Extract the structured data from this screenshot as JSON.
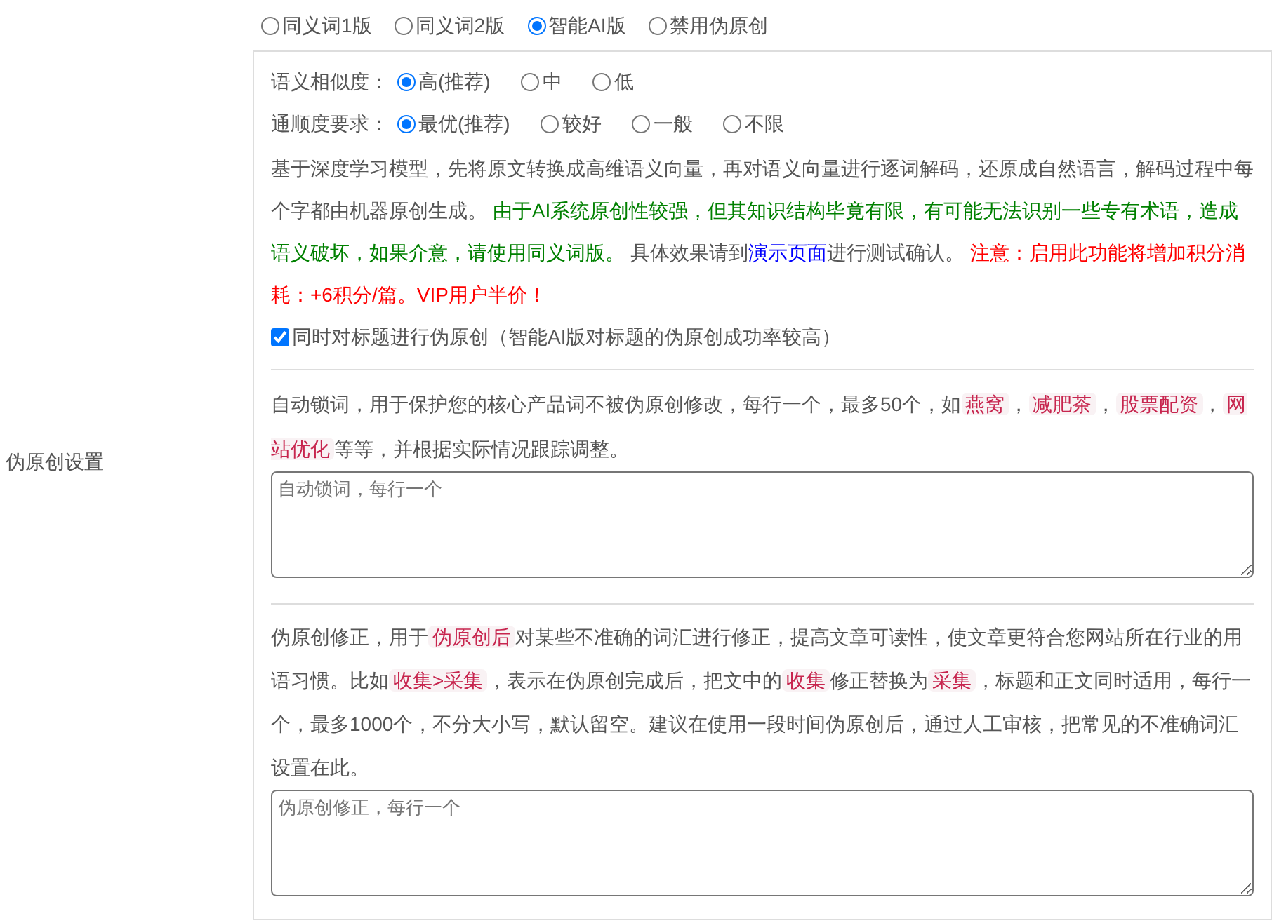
{
  "section_label": "伪原创设置",
  "modes": [
    {
      "label": "同义词1版",
      "selected": false
    },
    {
      "label": "同义词2版",
      "selected": false
    },
    {
      "label": "智能AI版",
      "selected": true
    },
    {
      "label": "禁用伪原创",
      "selected": false
    }
  ],
  "options": [
    {
      "label": "语义相似度：",
      "choices": [
        {
          "label": "高(推荐)",
          "selected": true
        },
        {
          "label": "中",
          "selected": false
        },
        {
          "label": "低",
          "selected": false
        }
      ]
    },
    {
      "label": "通顺度要求：",
      "choices": [
        {
          "label": "最优(推荐)",
          "selected": true
        },
        {
          "label": "较好",
          "selected": false
        },
        {
          "label": "一般",
          "selected": false
        },
        {
          "label": "不限",
          "selected": false
        }
      ]
    }
  ],
  "description": [
    {
      "kind": "text",
      "text": "基于深度学习模型，先将原文转换成高维语义向量，再对语义向量进行逐词解码，还原成自然语言，解码过程中每个字都由机器原创生成。 "
    },
    {
      "kind": "green",
      "text": "由于AI系统原创性较强，但其知识结构毕竟有限，有可能无法识别一些专有术语，造成语义破坏，如果介意，请使用同义词版。"
    },
    {
      "kind": "text",
      "text": " 具体效果请到"
    },
    {
      "kind": "link",
      "text": "演示页面"
    },
    {
      "kind": "text",
      "text": "进行测试确认。 "
    },
    {
      "kind": "red",
      "text": "注意：启用此功能将增加积分消耗：+6积分/篇。VIP用户半价！"
    }
  ],
  "title_option": {
    "label": "同时对标题进行伪原创（智能AI版对标题的伪原创成功率较高）",
    "checked": true
  },
  "lock_words": {
    "description": [
      {
        "kind": "text",
        "text": "自动锁词，用于保护您的核心产品词不被伪原创修改，每行一个，最多50个，如"
      },
      {
        "kind": "code",
        "text": "燕窝"
      },
      {
        "kind": "text",
        "text": "，"
      },
      {
        "kind": "code",
        "text": "减肥茶"
      },
      {
        "kind": "text",
        "text": "，"
      },
      {
        "kind": "code",
        "text": "股票配资"
      },
      {
        "kind": "text",
        "text": "，"
      },
      {
        "kind": "code",
        "text": "网站优化"
      },
      {
        "kind": "text",
        "text": "等等，并根据实际情况跟踪调整。"
      }
    ],
    "placeholder": "自动锁词，每行一个"
  },
  "corrections": {
    "description": [
      {
        "kind": "text",
        "text": "伪原创修正，用于"
      },
      {
        "kind": "code",
        "text": "伪原创后"
      },
      {
        "kind": "text",
        "text": "对某些不准确的词汇进行修正，提高文章可读性，使文章更符合您网站所在行业的用语习惯。比如"
      },
      {
        "kind": "code",
        "text": "收集>采集"
      },
      {
        "kind": "text",
        "text": "，表示在伪原创完成后，把文中的"
      },
      {
        "kind": "code",
        "text": "收集"
      },
      {
        "kind": "text",
        "text": "修正替换为"
      },
      {
        "kind": "code",
        "text": "采集"
      },
      {
        "kind": "text",
        "text": "，标题和正文同时适用，每行一个，最多1000个，不分大小写，默认留空。建议在使用一段时间伪原创后，通过人工审核，把常见的不准确词汇设置在此。"
      }
    ],
    "placeholder": "伪原创修正，每行一个"
  }
}
